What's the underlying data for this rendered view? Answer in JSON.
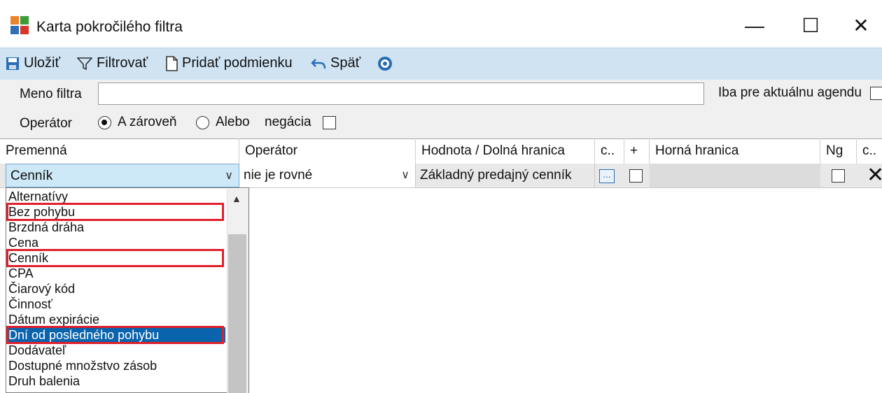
{
  "window": {
    "title": "Karta pokročilého filtra",
    "minimize_icon": "minimize-icon",
    "maximize_icon": "maximize-icon",
    "close_icon": "close-icon",
    "minimize_glyph": "—",
    "maximize_glyph": "☐",
    "close_glyph": "✕"
  },
  "toolbar": {
    "save_label": "Uložiť",
    "filter_label": "Filtrovať",
    "add_condition_label": "Pridať podmienku",
    "back_label": "Späť"
  },
  "form": {
    "filter_name_label": "Meno filtra",
    "filter_name_value": "",
    "current_agenda_label": "Iba pre aktuálnu agendu",
    "operator_label": "Operátor",
    "radio_and_label": "A zároveň",
    "radio_or_label": "Alebo",
    "negation_label": "negácia",
    "selected_operator": "A zároveň"
  },
  "grid": {
    "columns": [
      "Premenná",
      "Operátor",
      "Hodnota / Dolná hranica",
      "c..",
      "+",
      "Horná hranica",
      "Ng",
      "c.."
    ],
    "row": {
      "variable": "Cenník",
      "operator": "nie je rovné",
      "value": "Základný predajný cenník"
    }
  },
  "dropdown": {
    "items": [
      "Alternatívy",
      "Bez pohybu",
      "Brzdná dráha",
      "Cena",
      "Cenník",
      "CPA",
      "Čiarový kód",
      "Činnosť",
      "Dátum expirácie",
      "Dní od posledného pohybu",
      "Dodávateľ",
      "Dostupné množstvo zásob",
      "Druh balenia"
    ],
    "selected_item": "Dní od posledného pohybu",
    "highlighted_items": [
      "Bez pohybu",
      "Cenník",
      "Dní od posledného pohybu"
    ]
  },
  "colors": {
    "toolbar_bg": "#cfe3f3",
    "selection": "#0a64ad",
    "highlight_border": "#e0202a"
  }
}
